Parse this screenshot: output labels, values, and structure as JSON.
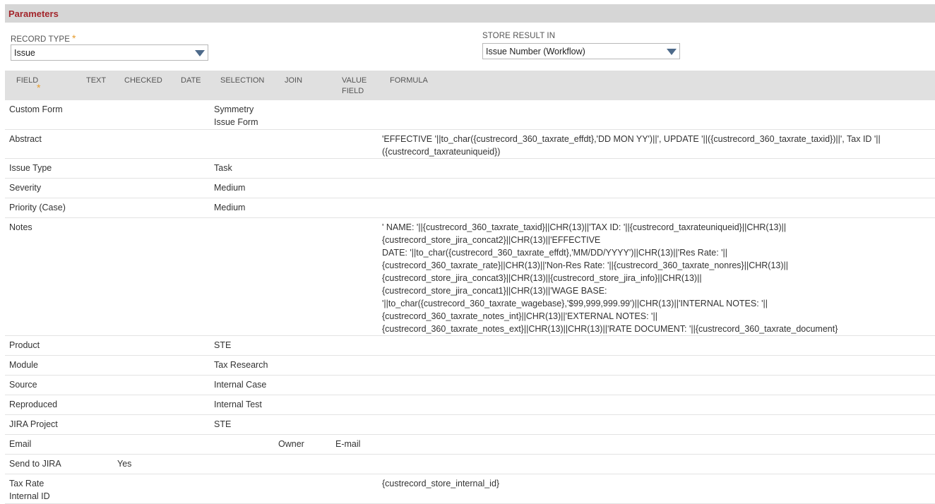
{
  "section": {
    "title": "Parameters"
  },
  "record_type": {
    "label": "RECORD TYPE",
    "required_mark": "*",
    "value": "Issue"
  },
  "store_result": {
    "label": "STORE RESULT IN",
    "value": "Issue Number (Workflow)"
  },
  "columns": {
    "field": "FIELD",
    "field_required": "*",
    "text": "TEXT",
    "checked": "CHECKED",
    "date": "DATE",
    "selection": "SELECTION",
    "join": "JOIN",
    "value_field_line1": "VALUE",
    "value_field_line2": "FIELD",
    "formula": "FORMULA"
  },
  "rows": [
    {
      "field": "Custom Form",
      "checked": "",
      "selection": "Symmetry\nIssue Form",
      "join": "",
      "value_field": "",
      "formula": ""
    },
    {
      "field": "Abstract",
      "checked": "",
      "selection": "",
      "join": "",
      "value_field": "",
      "formula": "'EFFECTIVE '||to_char({custrecord_360_taxrate_effdt},'DD MON YY')||', UPDATE '||({custrecord_360_taxrate_taxid})||', Tax ID '||({custrecord_taxrateuniqueid})"
    },
    {
      "field": "Issue Type",
      "checked": "",
      "selection": "Task",
      "join": "",
      "value_field": "",
      "formula": ""
    },
    {
      "field": "Severity",
      "checked": "",
      "selection": "Medium",
      "join": "",
      "value_field": "",
      "formula": ""
    },
    {
      "field": "Priority (Case)",
      "checked": "",
      "selection": "Medium",
      "join": "",
      "value_field": "",
      "formula": ""
    },
    {
      "field": "Notes",
      "checked": "",
      "selection": "",
      "join": "",
      "value_field": "",
      "formula": "' NAME: '||{custrecord_360_taxrate_taxid}||CHR(13)||'TAX ID: '||{custrecord_taxrateuniqueid}||CHR(13)||\n{custrecord_store_jira_concat2}||CHR(13)||'EFFECTIVE\nDATE: '||to_char({custrecord_360_taxrate_effdt},'MM/DD/YYYY')||CHR(13)||'Res Rate: '||\n{custrecord_360_taxrate_rate}||CHR(13)||'Non-Res Rate: '||{custrecord_360_taxrate_nonres}||CHR(13)||\n{custrecord_store_jira_concat3}||CHR(13)||{custrecord_store_jira_info}||CHR(13)||\n{custrecord_store_jira_concat1}||CHR(13)||'WAGE BASE:\n'||to_char({custrecord_360_taxrate_wagebase},'$99,999,999.99')||CHR(13)||'INTERNAL NOTES: '||\n{custrecord_360_taxrate_notes_int}||CHR(13)||'EXTERNAL NOTES: '||\n{custrecord_360_taxrate_notes_ext}||CHR(13)||CHR(13)||'RATE DOCUMENT: '||{custrecord_360_taxrate_document}"
    },
    {
      "field": "Product",
      "checked": "",
      "selection": "STE",
      "join": "",
      "value_field": "",
      "formula": ""
    },
    {
      "field": "Module",
      "checked": "",
      "selection": "Tax Research",
      "join": "",
      "value_field": "",
      "formula": ""
    },
    {
      "field": "Source",
      "checked": "",
      "selection": "Internal Case",
      "join": "",
      "value_field": "",
      "formula": ""
    },
    {
      "field": "Reproduced",
      "checked": "",
      "selection": "Internal Test",
      "join": "",
      "value_field": "",
      "formula": ""
    },
    {
      "field": "JIRA Project",
      "checked": "",
      "selection": "STE",
      "join": "",
      "value_field": "",
      "formula": ""
    },
    {
      "field": "Email",
      "checked": "",
      "selection": "",
      "join": "Owner",
      "value_field": "E-mail",
      "formula": ""
    },
    {
      "field": "Send to JIRA",
      "checked": "Yes",
      "selection": "",
      "join": "",
      "value_field": "",
      "formula": ""
    },
    {
      "field": "Tax Rate\nInternal ID",
      "checked": "",
      "selection": "",
      "join": "",
      "value_field": "",
      "formula": "{custrecord_store_internal_id}"
    }
  ]
}
